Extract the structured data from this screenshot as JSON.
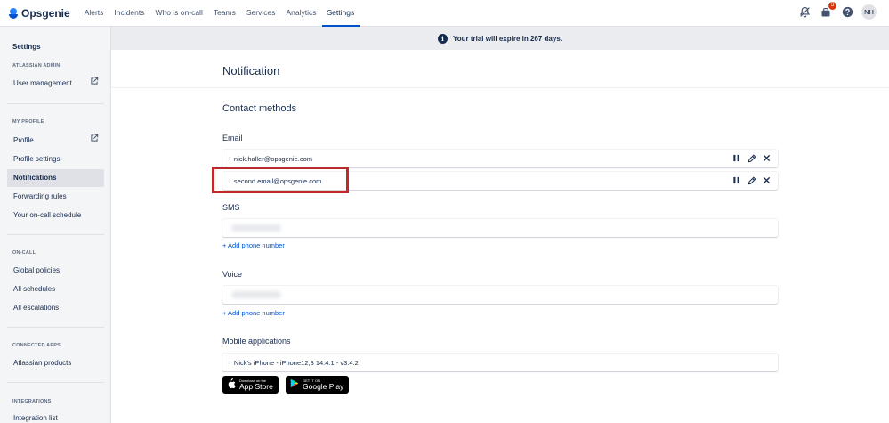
{
  "topbar": {
    "brand": "Opsgenie",
    "nav": [
      "Alerts",
      "Incidents",
      "Who is on-call",
      "Teams",
      "Services",
      "Analytics",
      "Settings"
    ],
    "active_nav": "Settings",
    "notification_count": "3",
    "avatar_initials": "NH"
  },
  "banner": {
    "text": "Your trial will expire in 267 days."
  },
  "sidebar": {
    "title": "Settings",
    "sections": {
      "atlassian_admin": "ATLASSIAN ADMIN",
      "my_profile": "MY PROFILE",
      "on_call": "ON-CALL",
      "connected_apps": "CONNECTED APPS",
      "integrations": "INTEGRATIONS"
    },
    "items": {
      "user_management": "User management",
      "profile": "Profile",
      "profile_settings": "Profile settings",
      "notifications": "Notifications",
      "forwarding_rules": "Forwarding rules",
      "on_call_schedule": "Your on-call schedule",
      "global_policies": "Global policies",
      "all_schedules": "All schedules",
      "all_escalations": "All escalations",
      "atlassian_products": "Atlassian products",
      "integration_list": "Integration list"
    }
  },
  "main": {
    "title": "Notification",
    "contact_methods": "Contact methods",
    "email": {
      "label": "Email",
      "entries": [
        "nick.haller@opsgenie.com",
        "second.email@opsgenie.com"
      ]
    },
    "sms": {
      "label": "SMS",
      "add": "+ Add phone number"
    },
    "voice": {
      "label": "Voice",
      "add": "+ Add phone number"
    },
    "mobile": {
      "label": "Mobile applications",
      "device": "Nick's iPhone - iPhone12,3 14.4.1 - v3.4.2",
      "app_store": {
        "small": "Download on the",
        "big": "App Store"
      },
      "google_play": {
        "small": "GET IT ON",
        "big": "Google Play"
      }
    }
  },
  "colors": {
    "accent": "#0052cc",
    "highlight": "#c0282d",
    "sidebar_bg": "#f4f5f7"
  }
}
